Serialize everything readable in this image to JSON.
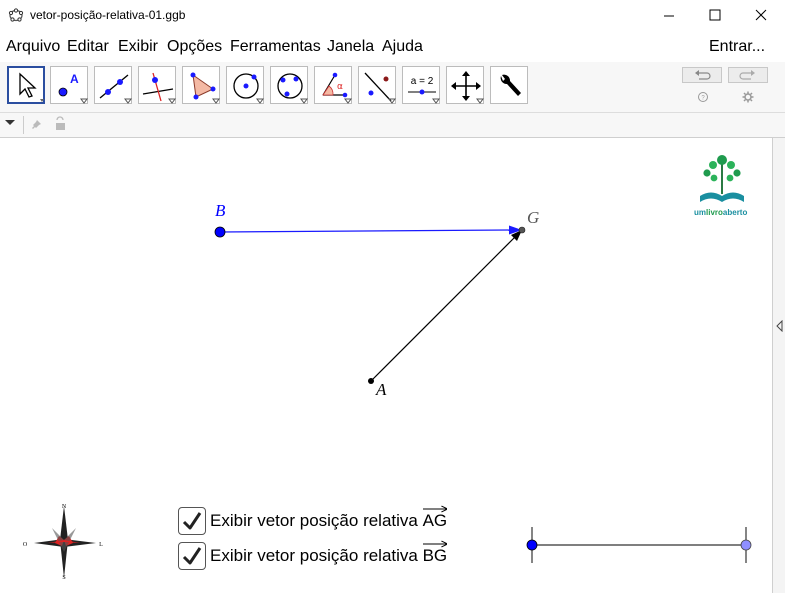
{
  "window": {
    "title": "vetor-posição-relativa-01.ggb"
  },
  "menu": [
    "Arquivo",
    "Editar",
    "Exibir",
    "Opções",
    "Ferramentas",
    "Janela",
    "Ajuda"
  ],
  "sign_in": "Entrar...",
  "toolbar": {
    "tools": [
      "move-tool",
      "point-tool",
      "line-tool",
      "perpendicular-tool",
      "polygon-tool",
      "circle-center-tool",
      "circle-three-points-tool",
      "angle-tool",
      "reflect-tool",
      "slider-tool",
      "move-view-tool",
      "settings-tool"
    ],
    "slider_tool_label": "a = 2"
  },
  "canvas": {
    "points": {
      "B": "B",
      "G": "G",
      "A": "A"
    },
    "vector_color": "#1a1aff",
    "point_B_color": "#0000ff"
  },
  "logo": {
    "text_um": "um",
    "text_livro": "livro",
    "text_aberto": "aberto"
  },
  "compass": {
    "n": "N",
    "s": "S",
    "o": "O",
    "l": "L"
  },
  "checkboxes": [
    {
      "label": "Exibir vetor posição relativa ",
      "vector": "AG",
      "checked": true
    },
    {
      "label": "Exibir vetor posição relativa ",
      "vector": "BG",
      "checked": true
    }
  ]
}
